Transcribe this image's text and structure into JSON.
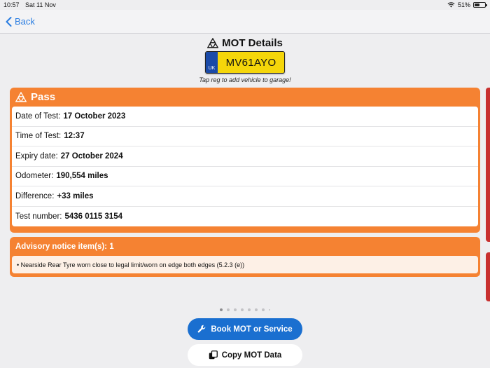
{
  "status_bar": {
    "time": "10:57",
    "date": "Sat 11 Nov",
    "battery": "51%",
    "battery_level": 0.51
  },
  "nav": {
    "back_label": "Back"
  },
  "header": {
    "title": "MOT Details",
    "plate_country": "UK",
    "registration": "MV61AYO",
    "hint": "Tap reg to add vehicle to garage!"
  },
  "result": {
    "status": "Pass",
    "rows": [
      {
        "label": "Date of Test:",
        "value": "17 October 2023"
      },
      {
        "label": "Time of Test:",
        "value": "12:37"
      },
      {
        "label": "Expiry date:",
        "value": "27 October 2024"
      },
      {
        "label": "Odometer:",
        "value": "190,554 miles"
      },
      {
        "label": "Difference:",
        "value": "+33 miles"
      },
      {
        "label": "Test number:",
        "value": "5436 0115 3154"
      }
    ]
  },
  "advisory": {
    "title": "Advisory notice item(s): 1",
    "items": [
      "• Nearside Rear Tyre worn close to legal limit/worn on edge  both edges (5.2.3 (e))"
    ]
  },
  "pagination": {
    "active_index": 0
  },
  "actions": {
    "book_label": "Book MOT or Service",
    "copy_label": "Copy MOT Data"
  },
  "colors": {
    "accent": "#f58232",
    "link": "#2a7de1",
    "primary_button": "#1a6fd0",
    "plate": "#f5d60a",
    "plate_band": "#1a4aa8",
    "side_card": "#c8302f"
  },
  "icons": {
    "title": "mot-triangle-icon",
    "pass": "mot-triangle-icon",
    "back": "chevron-left-icon",
    "book": "wrench-icon",
    "copy": "copy-icon",
    "wifi": "wifi-icon",
    "battery": "battery-icon"
  }
}
